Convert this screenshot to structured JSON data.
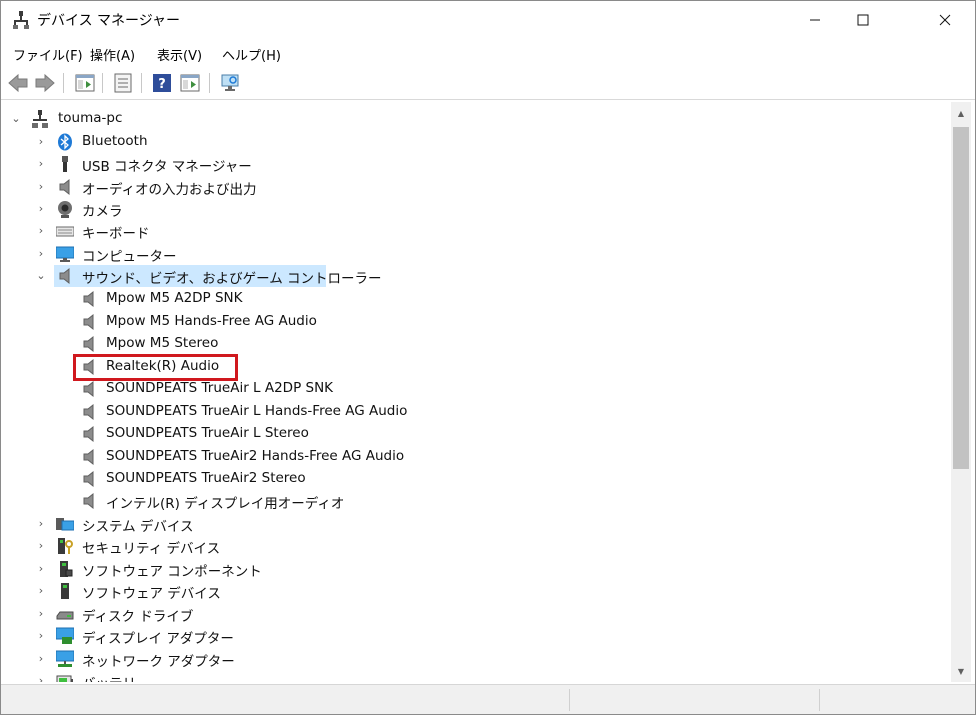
{
  "window": {
    "title": "デバイス マネージャー"
  },
  "menu": [
    "ファイル(F)",
    "操作(A)",
    "表示(V)",
    "ヘルプ(H)"
  ],
  "toolbar": [
    "back-icon",
    "forward-icon",
    "properties-pane-icon",
    "device-properties-icon",
    "help-icon",
    "update-driver-icon",
    "scan-hardware-icon"
  ],
  "tree": {
    "root": "touma-pc",
    "categories": [
      {
        "label": "Bluetooth",
        "icon": "bluetooth-icon"
      },
      {
        "label": "USB コネクタ マネージャー",
        "icon": "usb-connector-icon"
      },
      {
        "label": "オーディオの入力および出力",
        "icon": "speaker-icon"
      },
      {
        "label": "カメラ",
        "icon": "camera-icon"
      },
      {
        "label": "キーボード",
        "icon": "keyboard-icon"
      },
      {
        "label": "コンピューター",
        "icon": "monitor-icon"
      },
      {
        "label": "サウンド、ビデオ、およびゲーム コントローラー",
        "icon": "speaker-icon",
        "expanded": true,
        "selected": true
      },
      {
        "label": "システム デバイス",
        "icon": "system-device-icon"
      },
      {
        "label": "セキュリティ デバイス",
        "icon": "security-device-icon"
      },
      {
        "label": "ソフトウェア コンポーネント",
        "icon": "software-component-icon"
      },
      {
        "label": "ソフトウェア デバイス",
        "icon": "software-device-icon"
      },
      {
        "label": "ディスク ドライブ",
        "icon": "disk-drive-icon"
      },
      {
        "label": "ディスプレイ アダプター",
        "icon": "display-adapter-icon"
      },
      {
        "label": "ネットワーク アダプター",
        "icon": "network-adapter-icon"
      },
      {
        "label": "バッテリ",
        "icon": "battery-icon"
      }
    ],
    "sound_children": [
      "Mpow M5 A2DP SNK",
      "Mpow M5 Hands-Free AG Audio",
      "Mpow M5 Stereo",
      "Realtek(R) Audio",
      "SOUNDPEATS TrueAir L A2DP SNK",
      "SOUNDPEATS TrueAir L Hands-Free AG Audio",
      "SOUNDPEATS TrueAir L Stereo",
      "SOUNDPEATS TrueAir2 Hands-Free AG Audio",
      "SOUNDPEATS TrueAir2 Stereo",
      "インテル(R) ディスプレイ用オーディオ"
    ],
    "highlighted_child": "Realtek(R) Audio"
  },
  "colors": {
    "selection": "#cce8ff",
    "highlight_box": "#d0181e",
    "accent": "#1f7ad6"
  }
}
